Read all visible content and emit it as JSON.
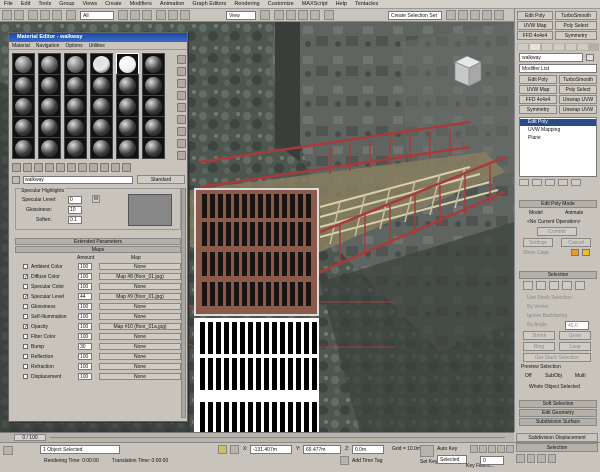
{
  "menubar": [
    "File",
    "Edit",
    "Tools",
    "Group",
    "Views",
    "Create",
    "Modifiers",
    "Animation",
    "Graph Editors",
    "Rendering",
    "Customize",
    "MAXScript",
    "Help",
    "Tentacles"
  ],
  "toolbar": {
    "filter": "All",
    "view": "View",
    "selection_set": "Create Selection Set"
  },
  "material_editor": {
    "title": "Material Editor - walkway",
    "menu": [
      "Material",
      "Navigation",
      "Options",
      "Utilities"
    ],
    "material_name": "walkway",
    "material_type": "Standard",
    "specular_highlights": {
      "label": "Specular Highlights",
      "specular_level_label": "Specular Level:",
      "specular_level": "0",
      "glossiness_label": "Glossiness:",
      "glossiness": "10",
      "soften_label": "Soften:",
      "soften": "0.1",
      "m_label": "M"
    },
    "extended_parameters": "Extended Parameters",
    "maps_label": "Maps",
    "amount_header": "Amount",
    "map_header": "Map",
    "maps": [
      {
        "name": "Ambient Color",
        "checked": "",
        "amount": "100",
        "map": "None"
      },
      {
        "name": "Diffuse Color",
        "checked": "✓",
        "amount": "100",
        "map": "Map #8 (floor_01.jpg)"
      },
      {
        "name": "Specular Color",
        "checked": "",
        "amount": "100",
        "map": "None"
      },
      {
        "name": "Specular Level",
        "checked": "✓",
        "amount": "44",
        "map": "Map #9 (floor_01.jpg)"
      },
      {
        "name": "Glossiness",
        "checked": "",
        "amount": "100",
        "map": "None"
      },
      {
        "name": "Self-Illumination",
        "checked": "",
        "amount": "100",
        "map": "None"
      },
      {
        "name": "Opacity",
        "checked": "✓",
        "amount": "100",
        "map": "Map #10 (floor_01a.jpg)"
      },
      {
        "name": "Filter Color",
        "checked": "",
        "amount": "100",
        "map": "None"
      },
      {
        "name": "Bump",
        "checked": "",
        "amount": "30",
        "map": "None"
      },
      {
        "name": "Reflection",
        "checked": "",
        "amount": "100",
        "map": "None"
      },
      {
        "name": "Refraction",
        "checked": "",
        "amount": "100",
        "map": "None"
      },
      {
        "name": "Displacement",
        "checked": "",
        "amount": "100",
        "map": "None"
      }
    ]
  },
  "command_panel": {
    "top_buttons": [
      "Edit Poly",
      "TurboSmooth",
      "UVW Map",
      "Poly Select",
      "FFD 4x4x4",
      "Symmetry"
    ],
    "object_name": "walkway",
    "modifier_list": "Modifier List",
    "modifier_buttons": [
      "Edit Poly",
      "TurboSmooth",
      "UVW Map",
      "Poly Select",
      "FFD 4x4x4",
      "Unwrap UVW",
      "Symmetry",
      "Unwrap UVW"
    ],
    "stack": [
      "Edit Poly",
      "UVW Mapping",
      "Plane"
    ],
    "edit_poly_mode": "Edit Poly Mode",
    "mode_model": "Model",
    "mode_animate": "Animate",
    "no_current_op": "<No Current Operation>",
    "commit": "Commit",
    "settings": "Settings",
    "cancel": "Cancel",
    "show_cage": "Show Cage",
    "selection": "Selection",
    "use_stack": "Use Stack Selection",
    "by_vertex": "By Vertex",
    "ignore_backfacing": "Ignore Backfacing",
    "by_angle": "By Angle",
    "by_angle_value": "45.0",
    "shrink": "Shrink",
    "grow": "Grow",
    "ring": "Ring",
    "loop": "Loop",
    "get_stack_selection": "Get Stack Selection",
    "preview_selection": "Preview Selection",
    "preview_off": "Off",
    "preview_subobj": "SubObj",
    "preview_multi": "Multi",
    "whole_object": "Whole Object Selected",
    "soft_selection": "Soft Selection",
    "edit_geometry": "Edit Geometry",
    "subdivision_surface": "Subdivision Surface",
    "subdivision_displacement": "Subdivision Displacement",
    "selection_bottom": "Selection"
  },
  "timeline": {
    "frame": "0 / 100"
  },
  "status": {
    "objects_selected": "1 Object Selected",
    "rendering_time": "Rendering Time: 0:00:00",
    "translation_time": "Translation Time: 0:00:00",
    "x_label": "X:",
    "x": "-131.407m",
    "y_label": "Y:",
    "y": "65.477m",
    "z_label": "Z:",
    "z": "0.0m",
    "grid": "Grid = 10.0m",
    "add_time_tag": "Add Time Tag",
    "auto_key": "Auto Key",
    "selected": "Selected",
    "set_key": "Set Key",
    "key_filters": "Key Filters...",
    "frame_field": "0"
  }
}
